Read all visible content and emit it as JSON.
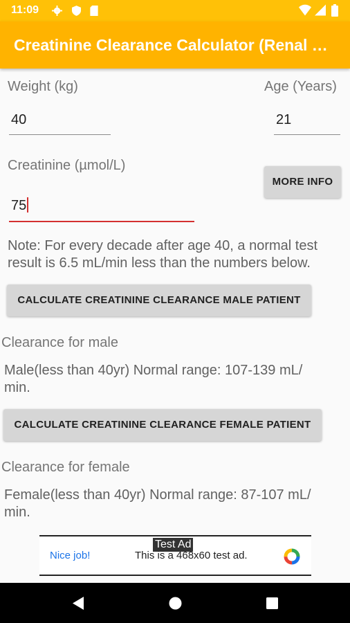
{
  "status_bar": {
    "time": "11:09",
    "icons": [
      "gear-icon",
      "shield-icon",
      "sd-card-icon",
      "wifi-icon",
      "signal-icon",
      "battery-icon"
    ]
  },
  "app_bar": {
    "title": "Creatinine Clearance Calculator (Renal Function)"
  },
  "form": {
    "weight_label": "Weight (kg)",
    "weight_value": "40",
    "age_label": "Age (Years)",
    "age_value": "21",
    "creatinine_label": "Creatinine (µmol/L)",
    "creatinine_value": "75",
    "more_info_label": "MORE INFO"
  },
  "note": {
    "line1": "Note: For every decade after age 40, a normal test",
    "line2": "result is 6.5 mL/min less than the numbers below."
  },
  "male": {
    "button_label": "CALCULATE CREATININE CLEARANCE MALE PATIENT",
    "clearance_label": "Clearance for male",
    "range_line1": "Male(less than 40yr) Normal range: 107-139 mL/",
    "range_line2": "min."
  },
  "female": {
    "button_label": "CALCULATE CREATININE CLEARANCE FEMALE PATIENT",
    "clearance_label": "Clearance for female",
    "range_line1": "Female(less than 40yr) Normal range: 87-107 mL/",
    "range_line2": "min."
  },
  "ad": {
    "badge": "Test Ad",
    "headline": "Nice job!",
    "description": "This is a 468x60 test ad."
  },
  "colors": {
    "status_bar": "#ffc107",
    "app_bar": "#ffb300",
    "focus_accent": "#d32f2f",
    "button": "#d6d6d6"
  }
}
